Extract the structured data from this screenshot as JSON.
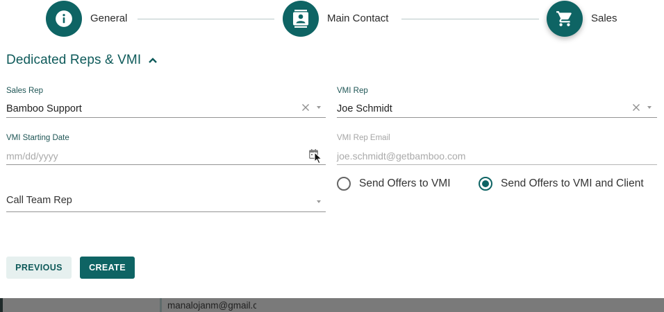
{
  "stepper": {
    "steps": [
      {
        "label": "General",
        "icon": "info-icon"
      },
      {
        "label": "Main Contact",
        "icon": "contact-card-icon"
      },
      {
        "label": "Sales",
        "icon": "shopping-cart-icon",
        "active": true
      }
    ]
  },
  "section": {
    "title": "Dedicated Reps & VMI",
    "expanded": true
  },
  "form": {
    "sales_rep": {
      "label": "Sales Rep",
      "value": "Bamboo Support"
    },
    "vmi_rep": {
      "label": "VMI Rep",
      "value": "Joe Schmidt"
    },
    "vmi_start_date": {
      "label": "VMI Starting Date",
      "placeholder": "mm/dd/yyyy"
    },
    "vmi_rep_email": {
      "label": "VMI Rep Email",
      "value": "joe.schmidt@getbamboo.com"
    },
    "call_team_rep": {
      "label": "Call Team Rep"
    },
    "offers": {
      "options": [
        "Send Offers to VMI",
        "Send Offers to VMI and Client"
      ],
      "selected": "Send Offers to VMI and Client"
    }
  },
  "buttons": {
    "previous": "PREVIOUS",
    "create": "CREATE"
  },
  "background_row": {
    "email_text": "manalojanm@gmail.c"
  },
  "colors": {
    "primary": "#0e6464",
    "primary_text": "#0e5a5a",
    "secondary_button_bg": "#e6f0ef"
  }
}
